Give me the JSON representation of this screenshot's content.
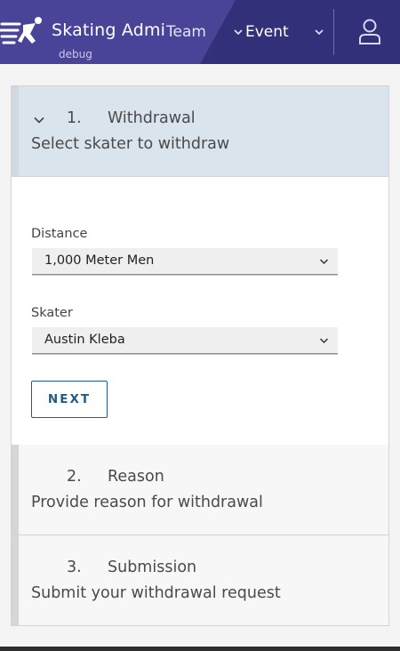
{
  "header": {
    "app_title": "Skating Admin",
    "app_subtitle": "debug",
    "nav": [
      {
        "label": "Team",
        "icon": "chevron-down-icon"
      },
      {
        "label": "Event",
        "icon": "chevron-down-icon"
      }
    ],
    "user_icon": "user-icon",
    "logo_icon": "skater-logo-icon",
    "colors": {
      "header_bg": "#33307a",
      "header_band": "#4a4499"
    }
  },
  "steps": [
    {
      "number": "1.",
      "title": "Withdrawal",
      "description": "Select skater to withdraw",
      "expanded": true
    },
    {
      "number": "2.",
      "title": "Reason",
      "description": "Provide reason for withdrawal",
      "expanded": false
    },
    {
      "number": "3.",
      "title": "Submission",
      "description": "Submit your withdrawal request",
      "expanded": false
    }
  ],
  "form": {
    "distance_label": "Distance",
    "distance_value": "1,000 Meter Men",
    "skater_label": "Skater",
    "skater_value": "Austin Kleba",
    "next_label": "NEXT"
  },
  "accent_color": "#1f5d88"
}
